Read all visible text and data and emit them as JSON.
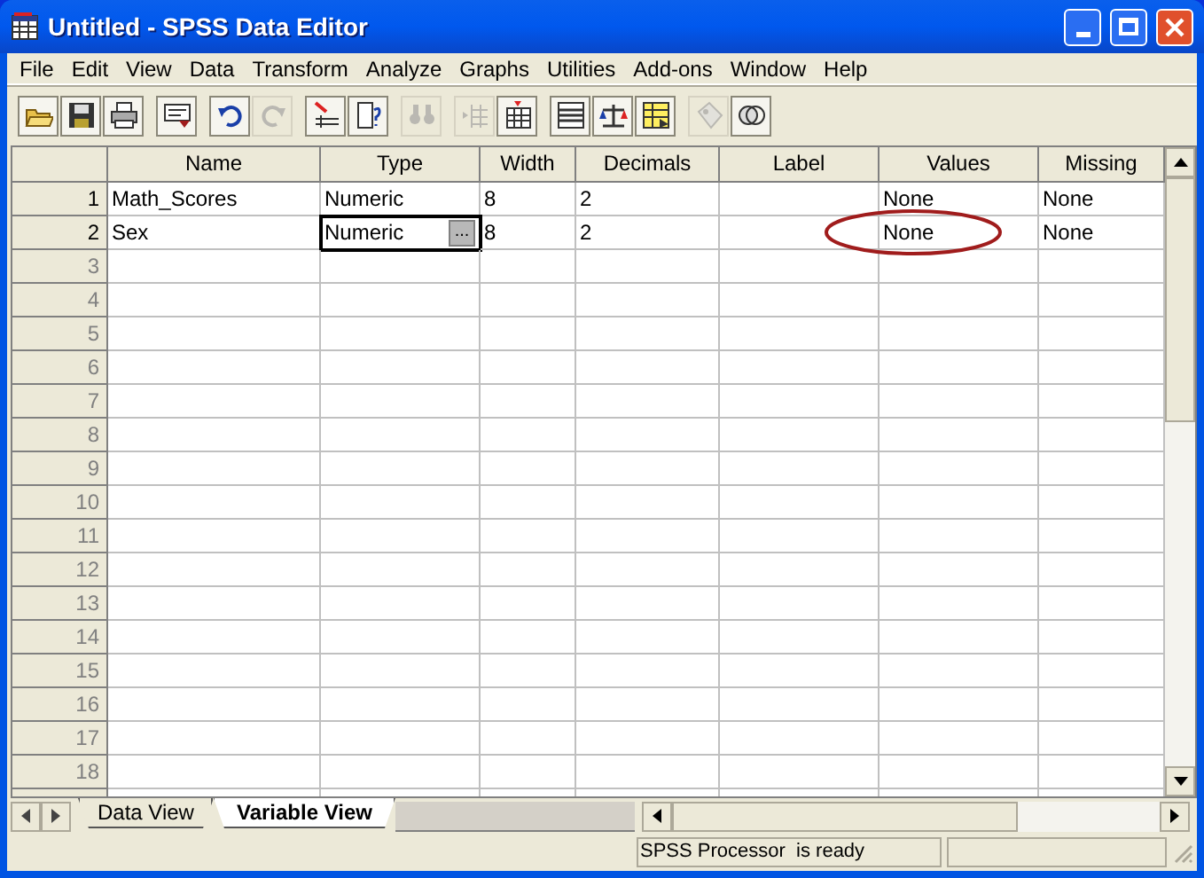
{
  "window": {
    "title": "Untitled - SPSS Data Editor"
  },
  "menu": [
    "File",
    "Edit",
    "View",
    "Data",
    "Transform",
    "Analyze",
    "Graphs",
    "Utilities",
    "Add-ons",
    "Window",
    "Help"
  ],
  "toolbar": [
    {
      "kind": "open",
      "disabled": false
    },
    {
      "kind": "save",
      "disabled": false
    },
    {
      "kind": "print",
      "disabled": false
    },
    {
      "kind": "separator"
    },
    {
      "kind": "dialog",
      "disabled": false
    },
    {
      "kind": "separator"
    },
    {
      "kind": "undo",
      "disabled": false
    },
    {
      "kind": "redo",
      "disabled": true
    },
    {
      "kind": "separator"
    },
    {
      "kind": "goto",
      "disabled": false
    },
    {
      "kind": "variables",
      "disabled": false
    },
    {
      "kind": "separator"
    },
    {
      "kind": "find",
      "disabled": true
    },
    {
      "kind": "separator"
    },
    {
      "kind": "insert-cases",
      "disabled": true
    },
    {
      "kind": "insert-variable",
      "disabled": false
    },
    {
      "kind": "separator"
    },
    {
      "kind": "split",
      "disabled": false
    },
    {
      "kind": "weight",
      "disabled": false
    },
    {
      "kind": "select",
      "disabled": false
    },
    {
      "kind": "separator"
    },
    {
      "kind": "value-labels",
      "disabled": true
    },
    {
      "kind": "sets",
      "disabled": false
    }
  ],
  "table": {
    "columns": [
      "Name",
      "Type",
      "Width",
      "Decimals",
      "Label",
      "Values",
      "Missing"
    ],
    "rows": [
      {
        "number": "1",
        "cells": [
          {
            "text": "Math_Scores",
            "selected": false,
            "circled": false
          },
          {
            "text": "Numeric",
            "selected": false,
            "circled": false
          },
          {
            "text": "8",
            "selected": false,
            "circled": false
          },
          {
            "text": "2",
            "selected": false,
            "circled": false
          },
          {
            "selected": false,
            "circled": false
          },
          {
            "text": "None",
            "selected": false,
            "circled": false
          },
          {
            "text": "None",
            "selected": false,
            "circled": false
          }
        ]
      },
      {
        "number": "2",
        "cells": [
          {
            "text": "Sex",
            "selected": false,
            "circled": false
          },
          {
            "text": "Numeric",
            "selected": true,
            "button": "...",
            "circled": false
          },
          {
            "text": "8",
            "selected": false,
            "circled": false
          },
          {
            "text": "2",
            "selected": false,
            "circled": false
          },
          {
            "selected": false,
            "circled": false
          },
          {
            "text": "None",
            "selected": false,
            "circled": true
          },
          {
            "text": "None",
            "selected": false,
            "circled": false
          }
        ]
      },
      {
        "number": "3"
      },
      {
        "number": "4"
      },
      {
        "number": "5"
      },
      {
        "number": "6"
      },
      {
        "number": "7"
      },
      {
        "number": "8"
      },
      {
        "number": "9"
      },
      {
        "number": "10"
      },
      {
        "number": "11"
      },
      {
        "number": "12"
      },
      {
        "number": "13"
      },
      {
        "number": "14"
      },
      {
        "number": "15"
      },
      {
        "number": "16"
      },
      {
        "number": "17"
      },
      {
        "number": "18"
      },
      {}
    ]
  },
  "tabs": [
    {
      "label": "Data View",
      "selected": false
    },
    {
      "label": "Variable View",
      "selected": true
    }
  ],
  "status_bar": {
    "text": "SPSS Processor  is ready"
  }
}
